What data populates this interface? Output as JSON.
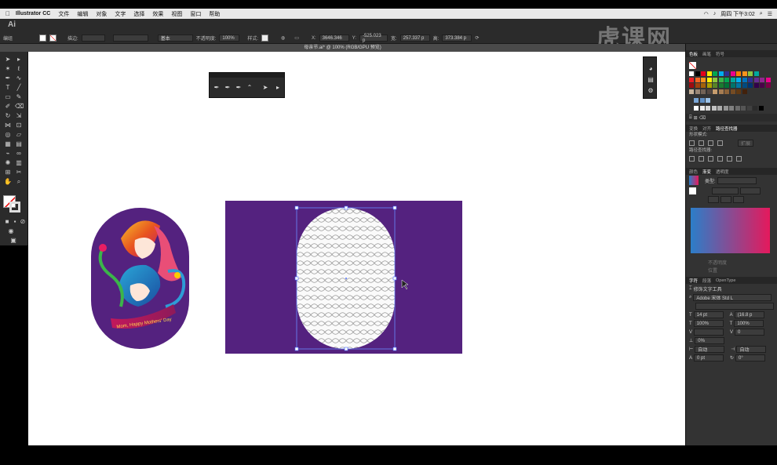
{
  "menubar": {
    "app_name": "Illustrator CC",
    "items": [
      "文件",
      "编辑",
      "对象",
      "文字",
      "选择",
      "效果",
      "视图",
      "窗口",
      "帮助"
    ],
    "clock": "周四 下午3:02"
  },
  "control_bar": {
    "logo": "Ai",
    "selection_label": "编组",
    "stroke_label": "描边:",
    "stroke_style": "基本",
    "opacity_label": "不透明度:",
    "opacity_value": "100%",
    "style_label": "样式:",
    "x_label": "X:",
    "x_value": "3646.346",
    "y_label": "Y:",
    "y_value": "-525.023 p",
    "w_label": "宽:",
    "w_value": "257.337 p",
    "h_label": "高:",
    "h_value": "373.384 p"
  },
  "watermark": "虎课网",
  "document": {
    "tab_title": "母亲节.ai* @ 100% (RGB/GPU 预览)"
  },
  "badge": {
    "banner_text": "Mom, Happy Mothers' Day"
  },
  "panels": {
    "swatches_tabs": [
      "色板",
      "画笔",
      "符号"
    ],
    "pathfinder_tabs": [
      "变换",
      "对齐",
      "路径查找器"
    ],
    "shape_modes_label": "形状模式:",
    "expand_button": "扩展",
    "pathfinder_label": "路径查找器:",
    "gradient_tabs": [
      "颜色",
      "渐变",
      "透明度"
    ],
    "gradient_type_label": "类型:",
    "opacity_label": "不透明度",
    "location_label": "位置",
    "char_tabs": [
      "字符",
      "段落",
      "OpenType"
    ],
    "touch_type": "修饰文字工具",
    "font_name": "Adobe 宋体 Std L",
    "font_size": "14 pt",
    "leading": "(16.8 p",
    "hscale": "100%",
    "vscale": "100%",
    "kerning": "0",
    "tracking_pct": "0%",
    "auto1": "自动",
    "auto2": "自动",
    "baseline": "0 pt",
    "rotation": "0°"
  },
  "colors": {
    "purple": "#54227f",
    "panel": "#333333",
    "gradient_start": "#2b7ec9",
    "gradient_end": "#e5195c"
  }
}
